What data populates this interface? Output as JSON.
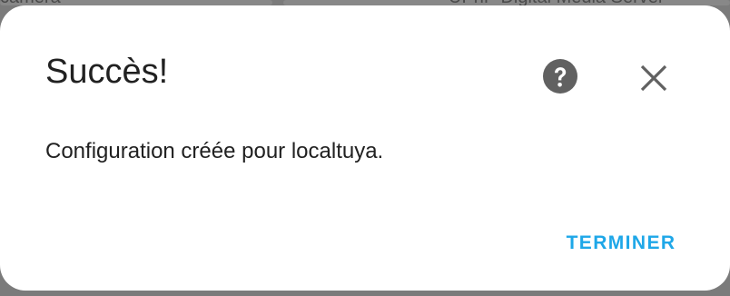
{
  "background": {
    "left_text": "camera",
    "right_text": "UPnP Digital Media Server"
  },
  "dialog": {
    "title": "Succès!",
    "message": "Configuration créée pour localtuya.",
    "finish_label": "TERMINER",
    "help_icon": "help-circle-icon",
    "close_icon": "close-icon",
    "accent_color": "#1ea7e8"
  }
}
